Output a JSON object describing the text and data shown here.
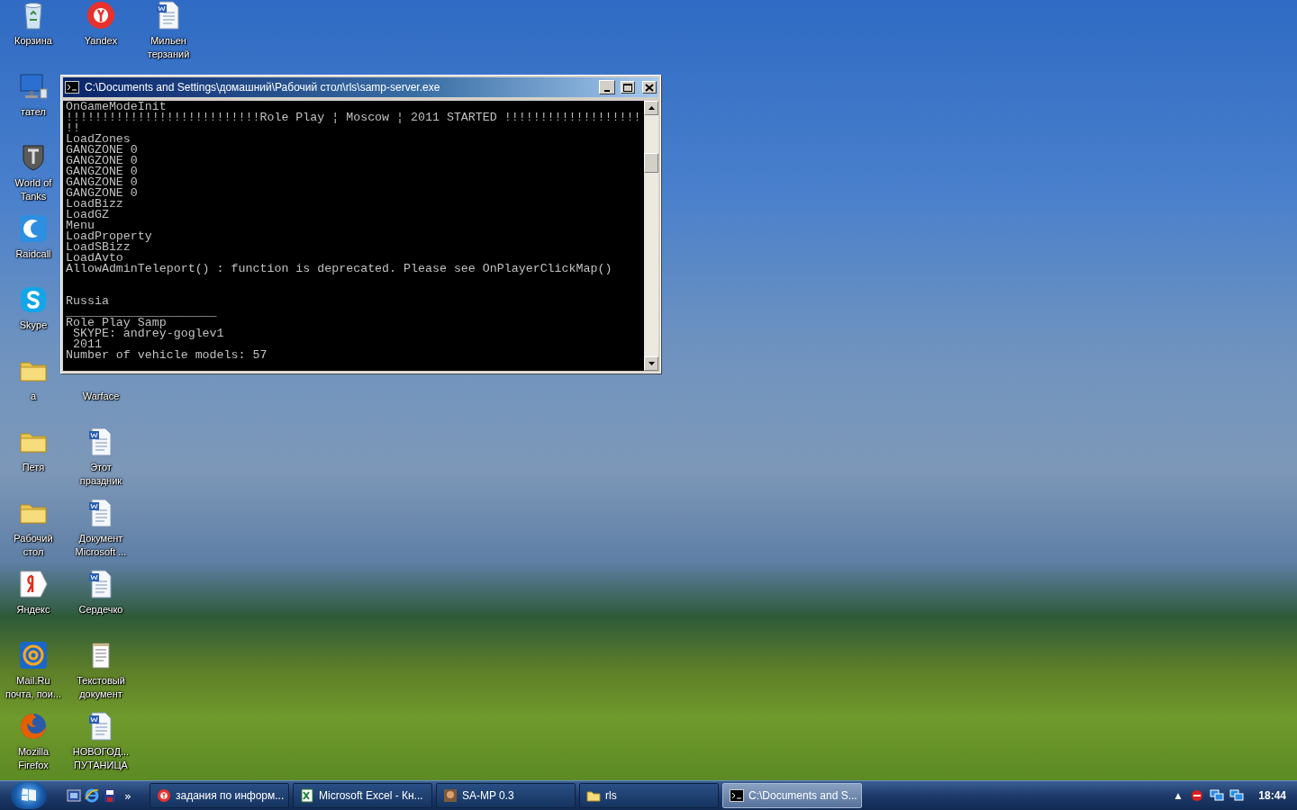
{
  "desktop_icons": [
    {
      "label": "Корзина",
      "kind": "bin"
    },
    {
      "label": "Yandex",
      "kind": "ybrowser"
    },
    {
      "label": "Мильен терзаний",
      "kind": "doc"
    },
    {
      "label": "тател",
      "kind": "monitor"
    },
    {
      "label": "World of Tanks",
      "kind": "tank"
    },
    {
      "label": "Raidcall",
      "kind": "raidcall"
    },
    {
      "label": "Skype",
      "kind": "skype"
    },
    {
      "label": "a",
      "kind": "folder"
    },
    {
      "label": "Warface",
      "kind": "hidden"
    },
    {
      "label": "Петя",
      "kind": "folder"
    },
    {
      "label": "Этот праздник",
      "kind": "doc"
    },
    {
      "label": "Рабочий стол",
      "kind": "folder"
    },
    {
      "label": "Документ Microsoft ...",
      "kind": "doc"
    },
    {
      "label": "Яндекс",
      "kind": "yandex"
    },
    {
      "label": "Сердечко",
      "kind": "doc"
    },
    {
      "label": "Mail.Ru почта, пои...",
      "kind": "mail"
    },
    {
      "label": "Текстовый документ",
      "kind": "text"
    },
    {
      "label": "Mozilla Firefox",
      "kind": "firefox"
    },
    {
      "label": "НОВОГОД... ПУТАНИЦА",
      "kind": "doc"
    }
  ],
  "window": {
    "title": "C:\\Documents and Settings\\домашний\\Рабочий стол\\rls\\samp-server.exe",
    "lines": [
      {
        "kind": "text",
        "text": "OnGameModeInit"
      },
      {
        "kind": "text",
        "text": "!!!!!!!!!!!!!!!!!!!!!!!!!!!Role Play ¦ Moscow ¦ 2011 STARTED !!!!!!!!!!!!!!!!!!!"
      },
      {
        "kind": "text",
        "text": "!!"
      },
      {
        "kind": "text",
        "text": "LoadZones"
      },
      {
        "kind": "text",
        "text": "GANGZONE 0"
      },
      {
        "kind": "text",
        "text": "GANGZONE 0"
      },
      {
        "kind": "text",
        "text": "GANGZONE 0"
      },
      {
        "kind": "text",
        "text": "GANGZONE 0"
      },
      {
        "kind": "text",
        "text": "GANGZONE 0"
      },
      {
        "kind": "text",
        "text": "LoadBizz"
      },
      {
        "kind": "text",
        "text": "LoadGZ"
      },
      {
        "kind": "text",
        "text": "Menu"
      },
      {
        "kind": "text",
        "text": "LoadProperty"
      },
      {
        "kind": "text",
        "text": "LoadSBizz"
      },
      {
        "kind": "text",
        "text": "LoadAvto"
      },
      {
        "kind": "text",
        "text": "AllowAdminTeleport() : function is deprecated. Please see OnPlayerClickMap()"
      },
      {
        "kind": "blank"
      },
      {
        "kind": "blank"
      },
      {
        "kind": "text",
        "text": "Russia"
      },
      {
        "kind": "text",
        "text": "_____________________"
      },
      {
        "kind": "text",
        "text": "Role Play Samp"
      },
      {
        "kind": "text",
        "text": " SKYPE: andrey-goglev1"
      },
      {
        "kind": "text",
        "text": " 2011"
      },
      {
        "kind": "text",
        "text": "Number of vehicle models: 57"
      }
    ]
  },
  "taskbar": {
    "quick_launch_more": "»",
    "tasks": [
      {
        "label": "задания по информ...",
        "kind": "ybrowser",
        "selected": false
      },
      {
        "label": "Microsoft Excel - Кн...",
        "kind": "excel",
        "selected": false
      },
      {
        "label": "SA-MP 0.3",
        "kind": "samp",
        "selected": false
      },
      {
        "label": "rls",
        "kind": "folder",
        "selected": false
      },
      {
        "label": "C:\\Documents and S...",
        "kind": "console",
        "selected": true
      }
    ],
    "tray_arrow": "▲",
    "clock": "18:44"
  }
}
